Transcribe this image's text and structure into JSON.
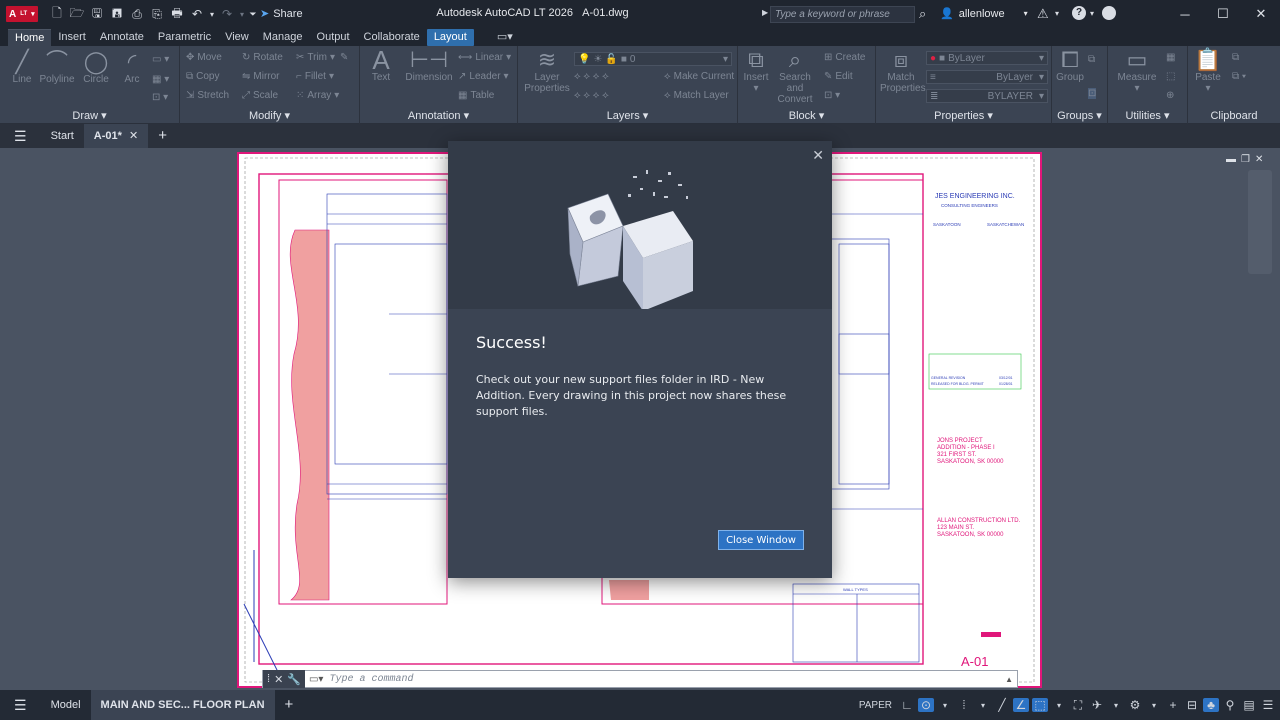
{
  "titlebar": {
    "app_name": "Autodesk AutoCAD LT 2026",
    "file_name": "A-01.dwg",
    "logo_letter": "A",
    "logo_suffix": "LT",
    "share_label": "Share",
    "search_placeholder": "Type a keyword or phrase",
    "username": "allenlowe"
  },
  "ribbon_tabs": [
    "Home",
    "Insert",
    "Annotate",
    "Parametric",
    "View",
    "Manage",
    "Output",
    "Collaborate",
    "Layout"
  ],
  "ribbon_active_tab": "Home",
  "ribbon_context_tab": "Layout",
  "panels": {
    "draw": {
      "title": "Draw",
      "items": [
        "Line",
        "Polyline",
        "Circle",
        "Arc"
      ]
    },
    "modify": {
      "title": "Modify",
      "items": [
        "Move",
        "Rotate",
        "Trim",
        "Copy",
        "Mirror",
        "Fillet",
        "Stretch",
        "Scale",
        "Array"
      ]
    },
    "annotation": {
      "title": "Annotation",
      "items": [
        "Text",
        "Dimension",
        "Linear",
        "Leader",
        "Table"
      ]
    },
    "layers": {
      "title": "Layers",
      "items": [
        "Layer Properties",
        "Make Current",
        "Match Layer"
      ],
      "current_layer": "0"
    },
    "block": {
      "title": "Block",
      "items": [
        "Insert",
        "Search and Convert",
        "Create",
        "Edit"
      ]
    },
    "properties": {
      "title": "Properties",
      "items": [
        "Match Properties",
        "ByLayer",
        "ByLayer",
        "BYLAYER"
      ]
    },
    "groups": {
      "title": "Groups",
      "items": [
        "Group"
      ]
    },
    "utilities": {
      "title": "Utilities",
      "items": [
        "Measure"
      ]
    },
    "clipboard": {
      "title": "Clipboard",
      "items": [
        "Paste"
      ]
    }
  },
  "doc_tabs": {
    "start": "Start",
    "active": "A-01*"
  },
  "modal": {
    "title": "Success!",
    "body": "Check out your new support files folder in IRD - New Addition. Every drawing in this project now shares these support files.",
    "button_label": "Close Window"
  },
  "drawing_text": {
    "company": "JES ENGINEERING INC.",
    "subtitle": "CONSULTING ENGINEERS",
    "city1": "SASKATOON",
    "city2": "SASKATCHEWAN",
    "project1": "JONS PROJECT",
    "project2": "ADDITION - PHASE I",
    "project3": "321 FIRST ST.",
    "project4": "SASKATOON, SK 00000",
    "client1": "ALLAN CONSTRUCTION LTD.",
    "client2": "123 MAIN ST.",
    "client3": "SASKATOON, SK 00000",
    "sheet_number": "A-01",
    "wall_types": "WALL TYPES",
    "rev1": "GENERAL REVISION",
    "rev2": "RELEASED FOR BLDG. PERMIT",
    "rev1_date": "03/12/01",
    "rev2_date": "01/28/01"
  },
  "command_line": {
    "placeholder": "Type a command"
  },
  "status_tabs": {
    "model": "Model",
    "layout": "MAIN AND SEC... FLOOR PLAN"
  },
  "status_paper": "PAPER",
  "colors": {
    "accent": "#2d73c4",
    "logo": "#c4122f",
    "border_magenta": "#e0167a"
  }
}
